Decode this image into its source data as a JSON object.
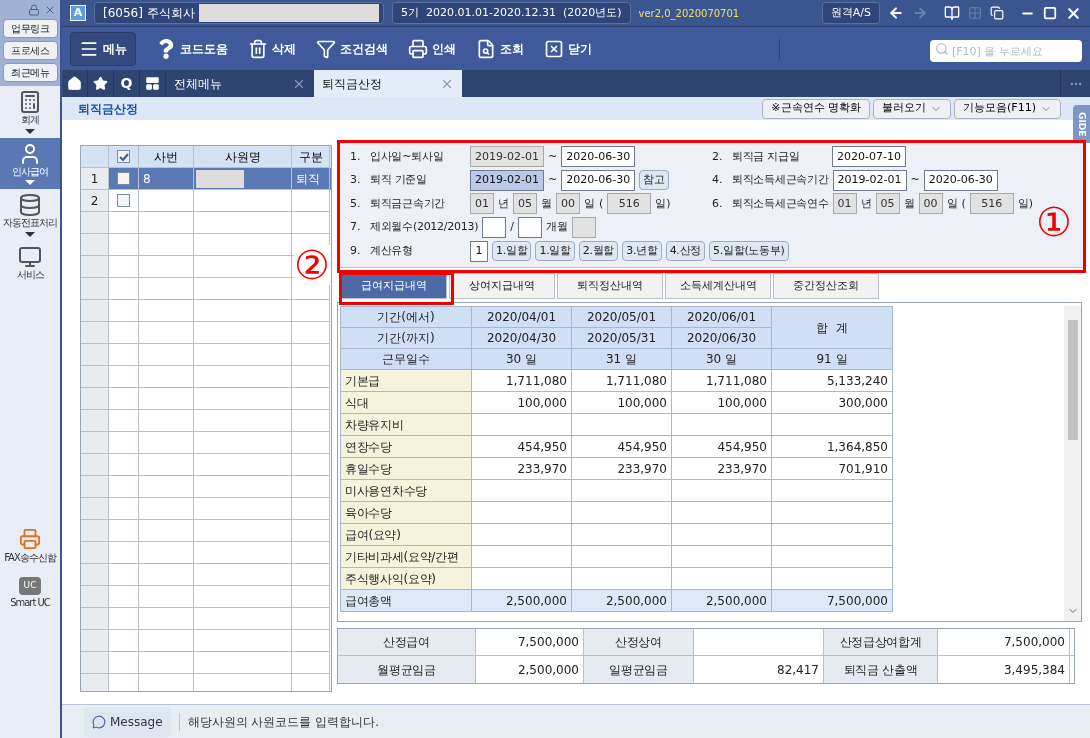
{
  "sidebar": {
    "quick_buttons": [
      "업무링크",
      "프로세스",
      "최근메뉴"
    ],
    "nav": [
      {
        "kind": "calculator",
        "label": "회계",
        "selected": false
      },
      {
        "kind": "person",
        "label": "인사급여",
        "selected": true
      },
      {
        "kind": "database",
        "label": "자동전표처리",
        "selected": false
      },
      {
        "kind": "monitor",
        "label": "서비스",
        "selected": false
      }
    ],
    "bottom": [
      {
        "kind": "fax",
        "label": "FAX송수신함"
      },
      {
        "kind": "chat",
        "label": "Smart UC",
        "badge": "UC"
      }
    ]
  },
  "title_bar": {
    "app_badge": "A",
    "company": "[6056] 주식회사",
    "company_hidden": true,
    "period": "5기  2020.01.01-2020.12.31  (2020년도)",
    "version": "ver2,0_2020070701",
    "remote_button": "원격A/S"
  },
  "toolbar": [
    {
      "kind": "menu",
      "label": "메뉴"
    },
    {
      "kind": "help",
      "label": "코드도움"
    },
    {
      "kind": "trash",
      "label": "삭제"
    },
    {
      "kind": "filter",
      "label": "조건검색"
    },
    {
      "kind": "print",
      "label": "인쇄"
    },
    {
      "kind": "lookup",
      "label": "조회"
    },
    {
      "kind": "close",
      "label": "닫기"
    }
  ],
  "search": {
    "placeholder": "[F10] 을 누르세요"
  },
  "tab_bar": {
    "quick": [
      {
        "kind": "home"
      },
      {
        "kind": "star"
      },
      {
        "kind": "text",
        "label": "Q"
      },
      {
        "kind": "board"
      }
    ],
    "tabs": [
      {
        "label": "전체메뉴",
        "selected": false
      },
      {
        "label": "퇴직금산정",
        "selected": true
      }
    ]
  },
  "page": {
    "title": "퇴직금산정",
    "buttons": [
      {
        "label": "※근속연수 명확화",
        "dropdown": false
      },
      {
        "label": "불러오기",
        "dropdown": true
      },
      {
        "label": "기능모음(F11)",
        "dropdown": true
      }
    ],
    "side_tab": "GIDE"
  },
  "employees": {
    "header_checked": true,
    "columns": [
      "사번",
      "사원명",
      "구분"
    ],
    "rows": [
      {
        "number": "1",
        "checked": false,
        "id": "8",
        "name_hidden": true,
        "type": "퇴직",
        "selected": true
      },
      {
        "number": "2",
        "checked": false,
        "selected": false
      }
    ]
  },
  "form": [
    {
      "left": [
        {
          "kind": "num",
          "text": "1."
        },
        {
          "kind": "label",
          "text": "입사일~퇴사일"
        },
        {
          "kind": "field",
          "value": "2019-02-01",
          "readonly": true,
          "focused": false
        },
        {
          "kind": "text",
          "text": "~"
        },
        {
          "kind": "field",
          "value": "2020-06-30",
          "readonly": false,
          "focused": false
        }
      ],
      "right": [
        {
          "kind": "num",
          "text": "2."
        },
        {
          "kind": "label",
          "text": "퇴직금 지급일"
        },
        {
          "kind": "field",
          "value": "2020-07-10",
          "readonly": false,
          "focused": false
        }
      ]
    },
    {
      "left": [
        {
          "kind": "num",
          "text": "3."
        },
        {
          "kind": "label",
          "text": "퇴직 기준일"
        },
        {
          "kind": "field",
          "value": "2019-02-01",
          "readonly": false,
          "focused": true
        },
        {
          "kind": "text",
          "text": "~"
        },
        {
          "kind": "field",
          "value": "2020-06-30",
          "readonly": false,
          "focused": false
        },
        {
          "kind": "button",
          "text": "참고"
        }
      ],
      "right": [
        {
          "kind": "num",
          "text": "4."
        },
        {
          "kind": "label",
          "text": "퇴직소득세근속기간"
        },
        {
          "kind": "field",
          "value": "2019-02-01",
          "readonly": false,
          "focused": false
        },
        {
          "kind": "text",
          "text": "~"
        },
        {
          "kind": "field",
          "value": "2020-06-30",
          "readonly": false,
          "focused": false
        }
      ]
    },
    {
      "left": [
        {
          "kind": "num",
          "text": "5."
        },
        {
          "kind": "label",
          "text": "퇴직금근속기간"
        },
        {
          "kind": "small",
          "value": "01",
          "readonly": true,
          "focused": false
        },
        {
          "kind": "text",
          "text": "년"
        },
        {
          "kind": "small",
          "value": "05",
          "readonly": true,
          "focused": false
        },
        {
          "kind": "text",
          "text": "월"
        },
        {
          "kind": "small",
          "value": "00",
          "readonly": true,
          "focused": false
        },
        {
          "kind": "text",
          "text": "일"
        },
        {
          "kind": "text",
          "text": "("
        },
        {
          "kind": "mid",
          "value": "516",
          "readonly": true,
          "focused": false
        },
        {
          "kind": "text",
          "text": "일)"
        }
      ],
      "right": [
        {
          "kind": "num",
          "text": "6."
        },
        {
          "kind": "label",
          "text": "퇴직소득세근속연수"
        },
        {
          "kind": "small",
          "value": "01",
          "readonly": true,
          "focused": false
        },
        {
          "kind": "text",
          "text": "년"
        },
        {
          "kind": "small",
          "value": "05",
          "readonly": true,
          "focused": false
        },
        {
          "kind": "text",
          "text": "월"
        },
        {
          "kind": "small",
          "value": "00",
          "readonly": true,
          "focused": false
        },
        {
          "kind": "text",
          "text": "일"
        },
        {
          "kind": "text",
          "text": "("
        },
        {
          "kind": "mid",
          "value": "516",
          "readonly": true,
          "focused": false
        },
        {
          "kind": "text",
          "text": "일)"
        }
      ]
    },
    {
      "left": [
        {
          "kind": "num",
          "text": "7."
        },
        {
          "kind": "label",
          "text": "제외월수(2012/2013)"
        },
        {
          "kind": "small",
          "readonly": false,
          "focused": false
        },
        {
          "kind": "text",
          "text": "/"
        },
        {
          "kind": "small",
          "readonly": false,
          "focused": false
        },
        {
          "kind": "text",
          "text": "개월"
        },
        {
          "kind": "small",
          "readonly": true,
          "focused": false
        }
      ]
    },
    {
      "left": [
        {
          "kind": "num",
          "text": "9."
        },
        {
          "kind": "label",
          "text": "계산유형"
        },
        {
          "kind": "tiny",
          "value": "1",
          "readonly": false,
          "focused": false
        },
        {
          "kind": "button",
          "text": "1.일할"
        },
        {
          "kind": "button",
          "text": "1.일할"
        },
        {
          "kind": "button",
          "text": "2.월할"
        },
        {
          "kind": "button",
          "text": "3.년할"
        },
        {
          "kind": "button",
          "text": "4.산정"
        },
        {
          "kind": "button",
          "text": "5.일할(노동부)"
        }
      ]
    }
  ],
  "detail_tabs": [
    {
      "label": "급여지급내역",
      "selected": true
    },
    {
      "label": "상여지급내역",
      "selected": false
    },
    {
      "label": "퇴직정산내역",
      "selected": false
    },
    {
      "label": "소득세계산내역",
      "selected": false
    },
    {
      "label": "중간정산조회",
      "selected": false
    }
  ],
  "salary_table": {
    "from_label": "기간(에서)",
    "to_label": "기간(까지)",
    "days_label": "근무일수",
    "total_label": "합  계",
    "periods": [
      {
        "from": "2020/04/01",
        "to": "2020/04/30",
        "days": "30 일"
      },
      {
        "from": "2020/05/01",
        "to": "2020/05/31",
        "days": "31 일"
      },
      {
        "from": "2020/06/01",
        "to": "2020/06/30",
        "days": "30 일"
      }
    ],
    "total_days": "91 일",
    "rows": [
      {
        "label": "기본급",
        "kind": "item",
        "values": [
          "1,711,080",
          "1,711,080",
          "1,711,080",
          "5,133,240"
        ]
      },
      {
        "label": "식대",
        "kind": "item",
        "values": [
          "100,000",
          "100,000",
          "100,000",
          "300,000"
        ]
      },
      {
        "label": "차량유지비",
        "kind": "item",
        "values": []
      },
      {
        "label": "연장수당",
        "kind": "item",
        "values": [
          "454,950",
          "454,950",
          "454,950",
          "1,364,850"
        ]
      },
      {
        "label": "휴일수당",
        "kind": "item",
        "values": [
          "233,970",
          "233,970",
          "233,970",
          "701,910"
        ]
      },
      {
        "label": "미사용연차수당",
        "kind": "item",
        "values": []
      },
      {
        "label": "육아수당",
        "kind": "item",
        "values": []
      },
      {
        "label": "급여(요약)",
        "kind": "item",
        "values": []
      },
      {
        "label": "기타비과세(요약/간편",
        "kind": "item",
        "values": []
      },
      {
        "label": "주식행사익(요약)",
        "kind": "item",
        "values": []
      },
      {
        "label": "급여총액",
        "kind": "total",
        "values": [
          "2,500,000",
          "2,500,000",
          "2,500,000",
          "7,500,000"
        ]
      }
    ]
  },
  "summary": [
    [
      {
        "label": "산정급여",
        "value": "7,500,000"
      },
      {
        "label": "산정상여"
      },
      {
        "label": "산정급상여합계",
        "value": "7,500,000"
      }
    ],
    [
      {
        "label": "월평균임금",
        "value": "2,500,000"
      },
      {
        "label": "일평균임금",
        "value": "82,417"
      },
      {
        "label": "퇴직금 산출액",
        "value": "3,495,384"
      }
    ]
  ],
  "message_bar": {
    "button": "Message",
    "text": "해당사원의 사원코드를 입력합니다."
  },
  "annotations": {
    "form_marker": "①",
    "tab_marker": "②"
  }
}
